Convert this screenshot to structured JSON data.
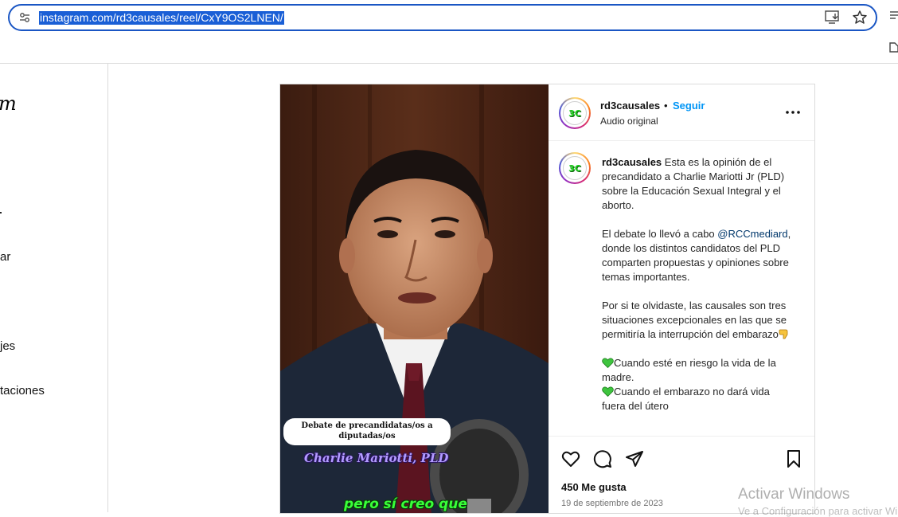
{
  "browser": {
    "url": "instagram.com/rd3causales/reel/CxY9OS2LNEN/"
  },
  "sidebar": {
    "logo_fragment": "m",
    "nav_fragments": [
      {
        "label": "ar"
      },
      {
        "label": "jes"
      },
      {
        "label": "taciones"
      }
    ]
  },
  "video": {
    "caption_box": "Debate de precandidatas/os a diputadas/os",
    "speaker_name": "Charlie Mariotti, PLD",
    "subtitle": "pero sí creo que"
  },
  "post": {
    "avatar_text": "3C",
    "username": "rd3causales",
    "separator": "•",
    "follow_label": "Seguir",
    "audio": "Audio original",
    "caption": {
      "p1": "Esta es la opinión de el precandidato a Charlie Mariotti Jr (PLD) sobre la Educación Sexual Integral y el aborto.",
      "p2_before": "El debate lo llevó a cabo",
      "mention": "@RCCmediard",
      "p2_after": ", donde los distintos candidatos del PLD comparten propuestas y opiniones sobre temas importantes.",
      "p3": "Por si te olvidaste, las causales son tres situaciones excepcionales en las que se permitiría la interrupción del embarazo",
      "item1": "Cuando esté en riesgo la vida de la madre.",
      "item2": "Cuando el embarazo no dará vida",
      "item2_cut": "fuera del útero"
    },
    "likes": "450 Me gusta",
    "date": "19 de septiembre de 2023"
  },
  "watermark": {
    "line1": "Activar Windows",
    "line2": "Ve a Configuración para activar Windows."
  },
  "colors": {
    "url_highlight": "#1a5fd6",
    "follow": "#0095f6",
    "mention": "#00376b",
    "subtitle_green": "#39ff39",
    "name_purple": "#b39cff"
  }
}
